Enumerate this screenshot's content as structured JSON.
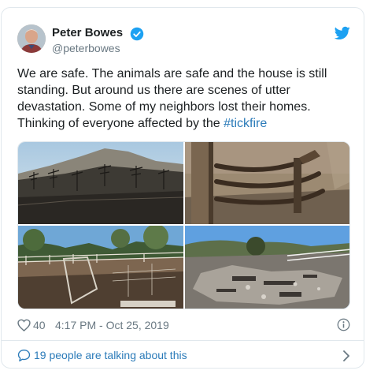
{
  "user": {
    "display_name": "Peter Bowes",
    "handle": "@peterbowes",
    "verified": true
  },
  "tweet": {
    "text": "We are safe. The animals are safe and the house is still standing. But around us there are scenes of utter devastation. Some of my neighbors lost their homes. Thinking of everyone affected by the ",
    "hashtag": "#tickfire",
    "likes": "40",
    "timestamp": "4:17 PM - Oct 25, 2019"
  },
  "conversation": {
    "label": "19 people are talking about this"
  },
  "icons": {
    "bird": "twitter-bird-icon",
    "verified": "verified-badge-icon",
    "heart": "heart-icon",
    "info": "info-icon",
    "bubble": "speech-bubble-icon",
    "chevron": "chevron-right-icon"
  },
  "colors": {
    "link": "#2b7bb9",
    "twitter_blue": "#1da1f2",
    "muted": "#697882",
    "border": "#e1e8ed"
  }
}
